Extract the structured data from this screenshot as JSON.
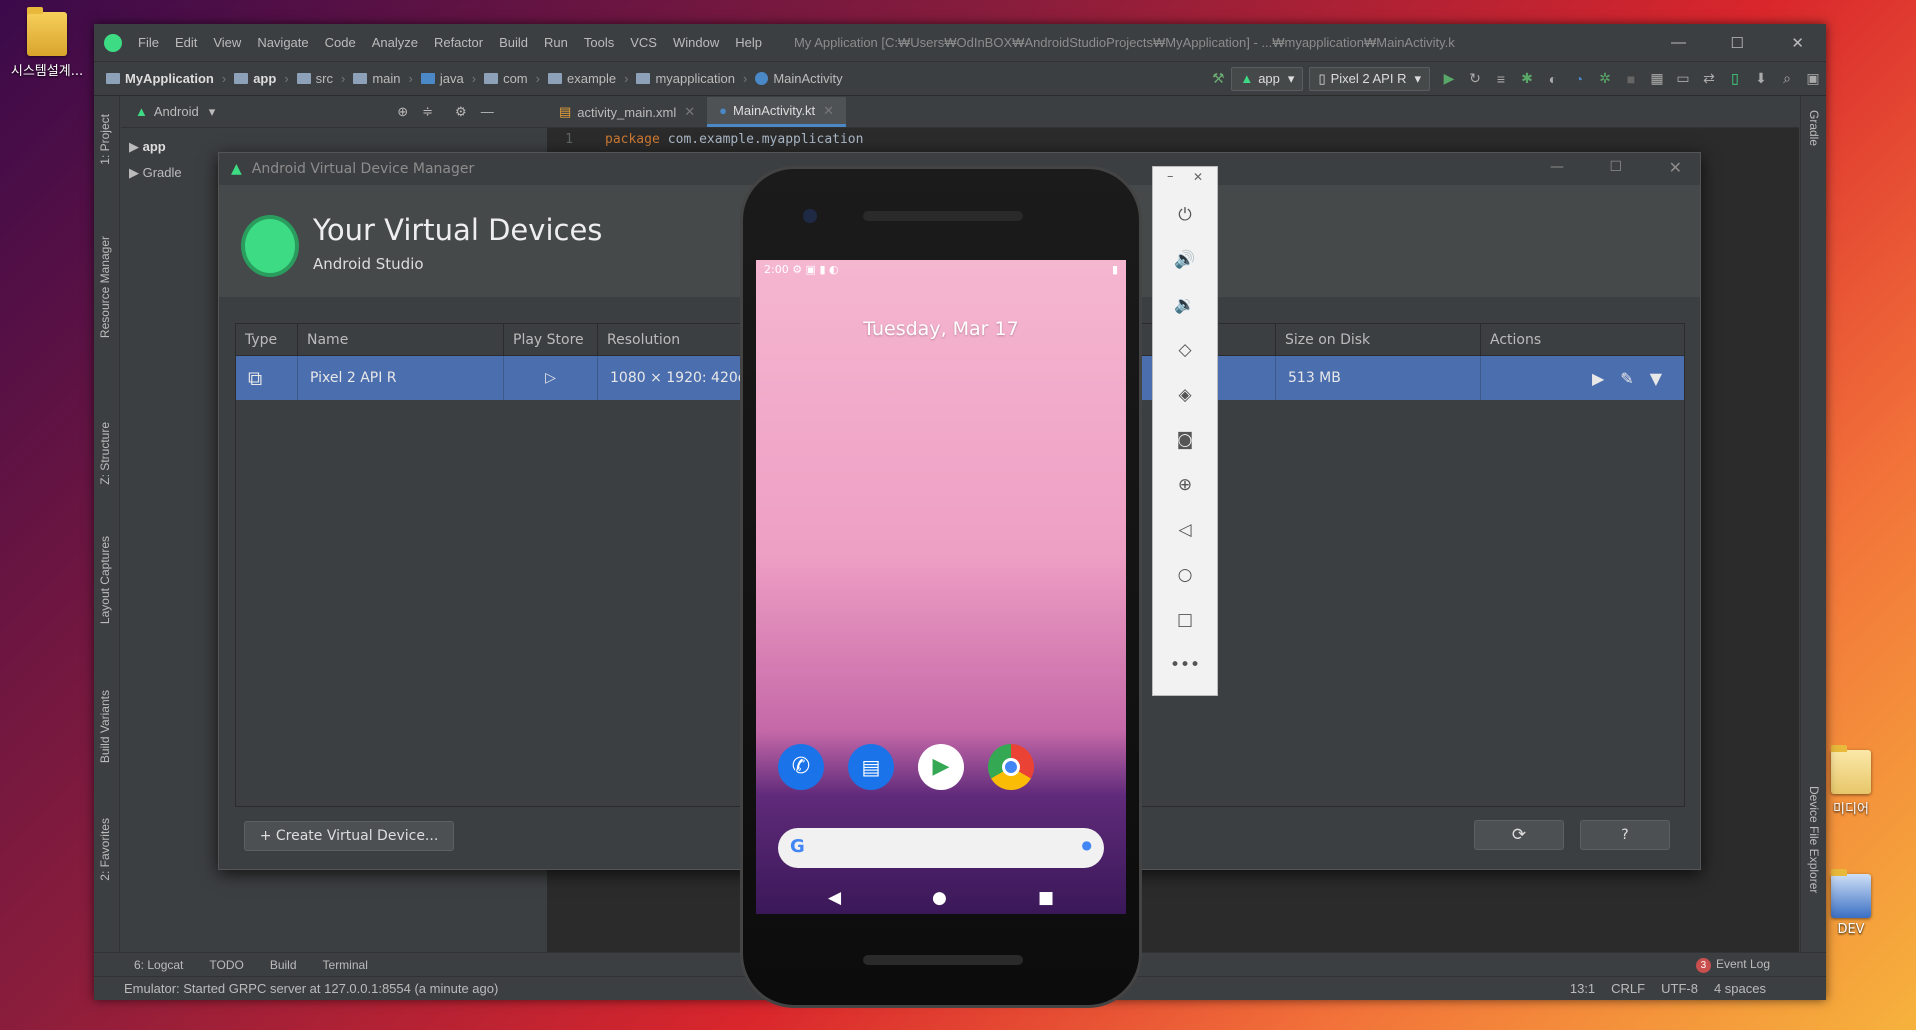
{
  "desktop": {
    "left_icon": "시스템설계...",
    "right_icons": [
      "미디어",
      "DEV"
    ]
  },
  "ide": {
    "menu": [
      "File",
      "Edit",
      "View",
      "Navigate",
      "Code",
      "Analyze",
      "Refactor",
      "Build",
      "Run",
      "Tools",
      "VCS",
      "Window",
      "Help"
    ],
    "title": "My Application [C:₩Users₩OdInBOX₩AndroidStudioProjects₩MyApplication] - ...₩myapplication₩MainActivity.k",
    "breadcrumb": [
      "MyApplication",
      "app",
      "src",
      "main",
      "java",
      "com",
      "example",
      "myapplication",
      "MainActivity"
    ],
    "run_config": "app",
    "device_config": "Pixel 2 API R",
    "project_view": "Android",
    "tree": [
      "app",
      "Gradle"
    ],
    "tabs": [
      "activity_main.xml",
      "MainActivity.kt"
    ],
    "code_line_no": "1",
    "code_kw": "package",
    "code_rest": "com.example.myapplication",
    "left_tools": [
      "1: Project",
      "Resource Manager",
      "Z: Structure",
      "Layout Captures",
      "Build Variants",
      "2: Favorites"
    ],
    "right_tools": [
      "Gradle",
      "Device File Explorer"
    ],
    "bottom_tools": [
      "6: Logcat",
      "TODO",
      "Build",
      "Terminal"
    ],
    "event_badge": "3",
    "event_log": "Event Log",
    "status_msg": "Emulator: Started GRPC server at 127.0.0.1:8554 (a minute ago)",
    "status_right": [
      "13:1",
      "CRLF",
      "UTF-8",
      "4 spaces"
    ]
  },
  "avd": {
    "window_title": "Android Virtual Device Manager",
    "heading": "Your Virtual Devices",
    "subheading": "Android Studio",
    "columns": [
      "Type",
      "Name",
      "Play Store",
      "Resolution",
      "Size on Disk",
      "Actions"
    ],
    "row": {
      "name": "Pixel 2 API R",
      "resolution": "1080 × 1920: 420dp",
      "size": "513 MB"
    },
    "create_button": "+ Create Virtual Device...",
    "help_button": "?"
  },
  "phone": {
    "time": "2:00",
    "date": "Tuesday, Mar 17"
  }
}
